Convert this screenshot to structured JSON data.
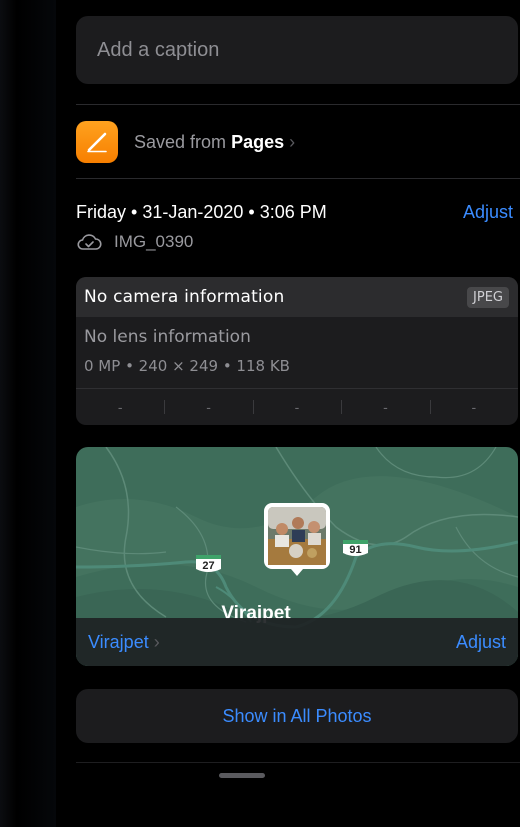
{
  "caption": {
    "placeholder": "Add a caption"
  },
  "source": {
    "prefix": "Saved from",
    "app": "Pages"
  },
  "meta": {
    "date": "Friday • 31-Jan-2020 • 3:06 PM",
    "adjust": "Adjust",
    "filename": "IMG_0390"
  },
  "exif": {
    "camera": "No camera information",
    "format": "JPEG",
    "lens": "No lens information",
    "specs": "0 MP • 240 × 249 • 118 KB",
    "values": [
      "-",
      "-",
      "-",
      "-",
      "-"
    ]
  },
  "map": {
    "town": "Virajpet",
    "place": "Virajpet",
    "adjust": "Adjust",
    "routes": [
      "27",
      "91"
    ]
  },
  "actions": {
    "show_all": "Show in All Photos"
  },
  "colors": {
    "accent": "#3b8cff",
    "card": "#1c1c1e",
    "map_land": "#3e6d5a"
  }
}
